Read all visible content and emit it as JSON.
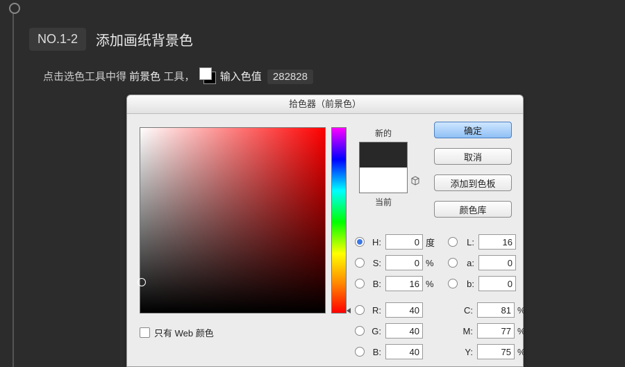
{
  "step": {
    "no": "NO.1-2",
    "title": "添加画纸背景色"
  },
  "instr": {
    "pre": "点击选色工具中得 ",
    "fg_tool": "前景色",
    "mid": " 工具，",
    "hex_label": "输入色值",
    "hex": "282828"
  },
  "picker": {
    "title": "拾色器（前景色）",
    "new_label": "新的",
    "current_label": "当前",
    "buttons": {
      "ok": "确定",
      "cancel": "取消",
      "add": "添加到色板",
      "lib": "颜色库"
    },
    "web_only": "只有 Web 颜色",
    "hsb": {
      "H": {
        "label": "H:",
        "val": "0",
        "unit": "度",
        "on": true
      },
      "S": {
        "label": "S:",
        "val": "0",
        "unit": "%",
        "on": false
      },
      "B": {
        "label": "B:",
        "val": "16",
        "unit": "%",
        "on": false
      }
    },
    "lab": {
      "L": {
        "label": "L:",
        "val": "16",
        "on": false
      },
      "a": {
        "label": "a:",
        "val": "0",
        "on": false
      },
      "b": {
        "label": "b:",
        "val": "0",
        "on": false
      }
    },
    "rgb": {
      "R": {
        "label": "R:",
        "val": "40",
        "on": false
      },
      "G": {
        "label": "G:",
        "val": "40",
        "on": false
      },
      "B": {
        "label": "B:",
        "val": "40",
        "on": false
      }
    },
    "cmyk": {
      "C": {
        "label": "C:",
        "val": "81",
        "unit": "%"
      },
      "M": {
        "label": "M:",
        "val": "77",
        "unit": "%"
      },
      "Y": {
        "label": "Y:",
        "val": "75",
        "unit": "%"
      }
    }
  }
}
